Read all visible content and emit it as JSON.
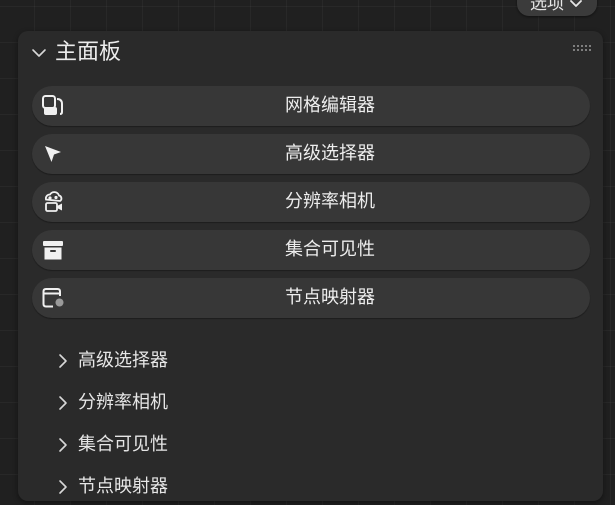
{
  "options_button": {
    "label": "选项",
    "chevron_icon": "chevron-down-icon"
  },
  "panel": {
    "title": "主面板",
    "collapse_icon": "chevron-down-icon",
    "grip_icon": "grip-dots-icon",
    "tools": [
      {
        "label": "网格编辑器",
        "icon": "mesh-editor-icon"
      },
      {
        "label": "高级选择器",
        "icon": "cursor-arrow-icon"
      },
      {
        "label": "分辨率相机",
        "icon": "video-camera-icon"
      },
      {
        "label": "集合可见性",
        "icon": "archive-box-icon"
      },
      {
        "label": "节点映射器",
        "icon": "node-mapper-icon"
      }
    ],
    "subpanels": [
      {
        "label": "高级选择器",
        "icon": "chevron-right-icon"
      },
      {
        "label": "分辨率相机",
        "icon": "chevron-right-icon"
      },
      {
        "label": "集合可见性",
        "icon": "chevron-right-icon"
      },
      {
        "label": "节点映射器",
        "icon": "chevron-right-icon"
      }
    ]
  }
}
